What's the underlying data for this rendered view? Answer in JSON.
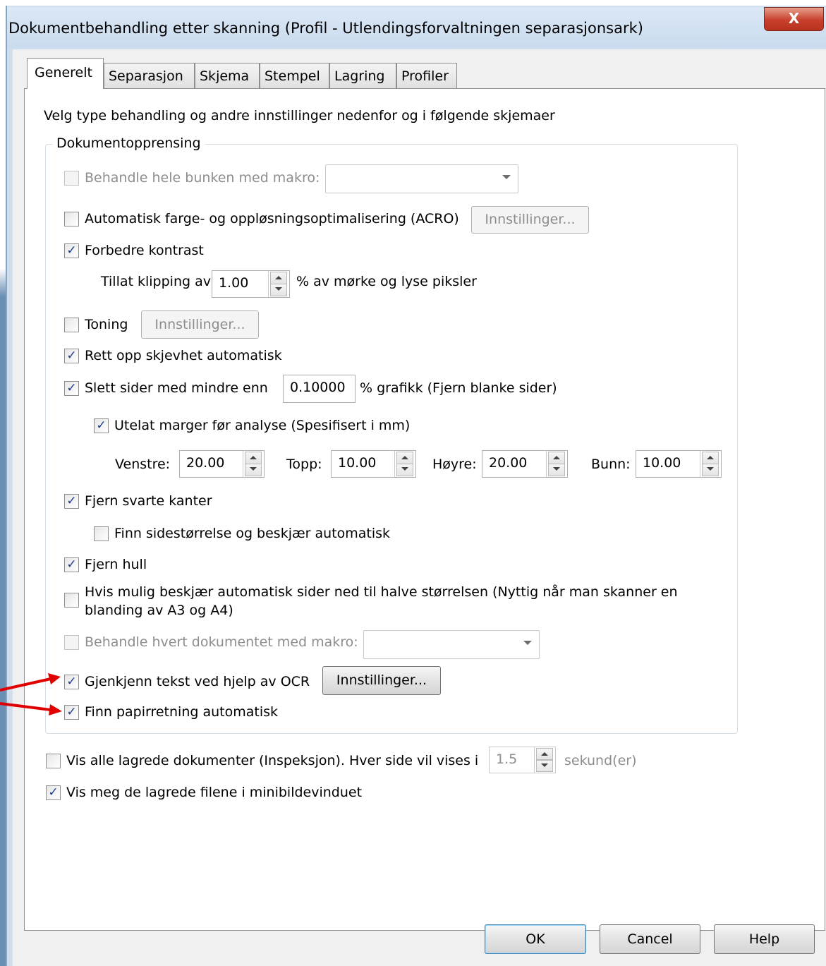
{
  "window": {
    "title": "Dokumentbehandling etter skanning (Profil - Utlendingsforvaltningen separasjonsark)",
    "close_glyph": "X"
  },
  "tabs": [
    {
      "label": "Generelt",
      "active": true
    },
    {
      "label": "Separasjon"
    },
    {
      "label": "Skjema"
    },
    {
      "label": "Stempel"
    },
    {
      "label": "Lagring"
    },
    {
      "label": "Profiler"
    }
  ],
  "intro": "Velg type behandling og andre innstillinger nedenfor og i følgende skjemaer",
  "group": {
    "title": "Dokumentopprensing",
    "macro_all": {
      "label": "Behandle hele bunken med makro:",
      "checked": false,
      "enabled": false,
      "value": ""
    },
    "acro": {
      "label": "Automatisk farge- og oppløsningsoptimalisering (ACRO)",
      "checked": false,
      "button": "Innstillinger..."
    },
    "contrast": {
      "label": "Forbedre kontrast",
      "checked": true
    },
    "clip": {
      "label": "Tillat klipping av",
      "value": "1.00",
      "suffix": "% av mørke og lyse piksler"
    },
    "toning": {
      "label": "Toning",
      "checked": false,
      "button": "Innstillinger..."
    },
    "deskew": {
      "label": "Rett opp skjevhet automatisk",
      "checked": true
    },
    "delete_pages": {
      "label": "Slett sider med mindre enn",
      "checked": true,
      "value": "0.10000",
      "suffix": "% grafikk (Fjern blanke sider)"
    },
    "margins": {
      "label": "Utelat marger før analyse (Spesifisert i mm)",
      "checked": true,
      "left_label": "Venstre:",
      "left": "20.00",
      "top_label": "Topp:",
      "top": "10.00",
      "right_label": "Høyre:",
      "right": "20.00",
      "bottom_label": "Bunn:",
      "bottom": "10.00"
    },
    "black_borders": {
      "label": "Fjern svarte kanter",
      "checked": true
    },
    "crop_auto": {
      "label": "Finn sidestørrelse og beskjær automatisk",
      "checked": false
    },
    "holes": {
      "label": "Fjern hull",
      "checked": true
    },
    "half_crop": {
      "label_line1": "Hvis mulig beskjær automatisk sider ned til halve størrelsen (Nyttig når man skanner en",
      "label_line2": "blanding av A3 og A4)",
      "checked": false
    },
    "macro_doc": {
      "label": "Behandle hvert dokumentet med makro:",
      "checked": false,
      "enabled": false,
      "value": ""
    },
    "ocr": {
      "label": "Gjenkjenn tekst ved hjelp av OCR",
      "checked": true,
      "button": "Innstillinger..."
    },
    "orientation": {
      "label": "Finn papirretning automatisk",
      "checked": true
    }
  },
  "inspection": {
    "label": "Vis alle lagrede dokumenter (Inspeksjon). Hver side vil vises i",
    "checked": false,
    "value": "1.5",
    "suffix": "sekund(er)"
  },
  "thumbnails": {
    "label": "Vis meg de lagrede filene i minibildevinduet",
    "checked": true
  },
  "buttons": {
    "ok": "OK",
    "cancel": "Cancel",
    "help": "Help"
  },
  "check_glyph": "✓",
  "colors": {
    "arrow": "#e00000",
    "check": "#1e3c8c",
    "title_bg": "#dbe8f5",
    "close_bg": "#c7402b"
  }
}
